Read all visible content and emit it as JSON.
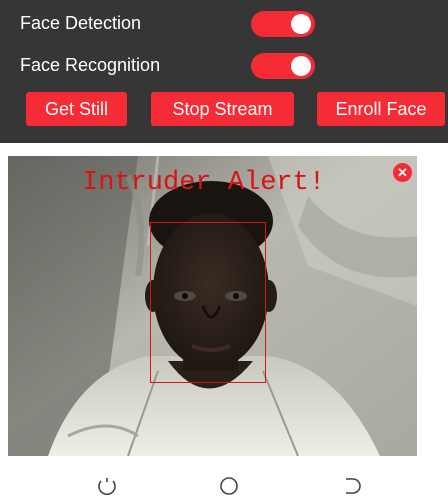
{
  "controls": {
    "face_detection": {
      "label": "Face Detection",
      "on": true
    },
    "face_recognition": {
      "label": "Face Recognition",
      "on": true
    }
  },
  "buttons": {
    "get_still": "Get Still",
    "stop_stream": "Stop Stream",
    "enroll_face": "Enroll Face"
  },
  "stream": {
    "alert_text": "Intruder Alert!",
    "close_symbol": "✕"
  },
  "colors": {
    "panel_bg": "#363636",
    "accent": "#f52b35",
    "alert_red": "#d81515"
  },
  "nav": {
    "icons": [
      "recent-apps-icon",
      "home-icon",
      "back-icon"
    ]
  }
}
